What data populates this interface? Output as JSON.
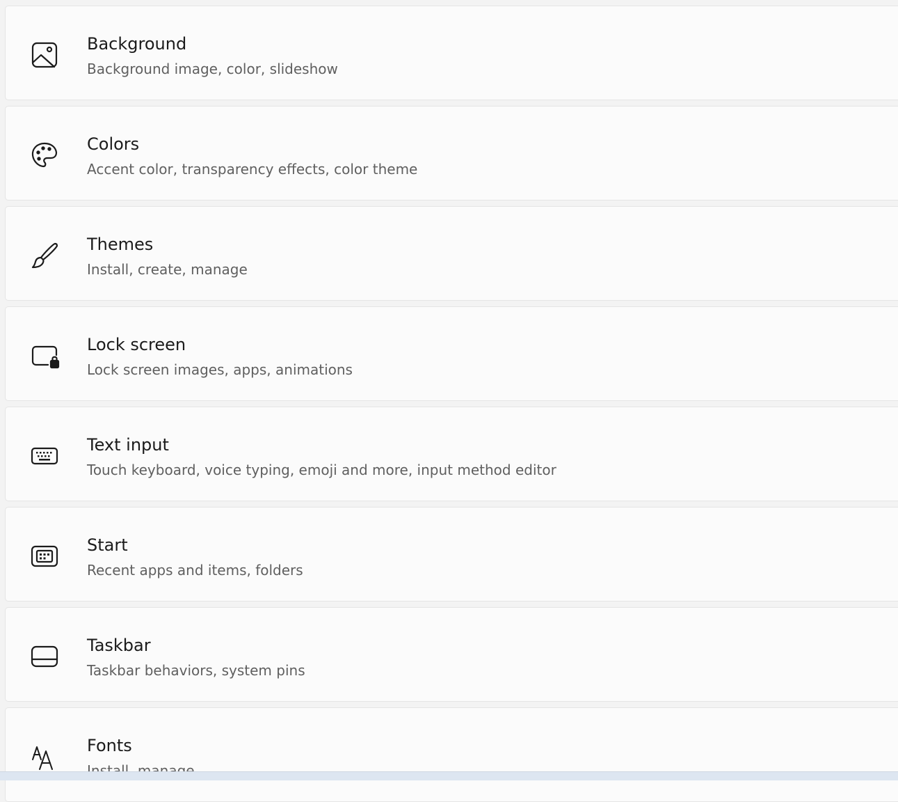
{
  "items": [
    {
      "title": "Background",
      "subtitle": "Background image, color, slideshow",
      "icon": "image-icon"
    },
    {
      "title": "Colors",
      "subtitle": "Accent color, transparency effects, color theme",
      "icon": "palette-icon"
    },
    {
      "title": "Themes",
      "subtitle": "Install, create, manage",
      "icon": "brush-icon"
    },
    {
      "title": "Lock screen",
      "subtitle": "Lock screen images, apps, animations",
      "icon": "lock-screen-icon"
    },
    {
      "title": "Text input",
      "subtitle": "Touch keyboard, voice typing, emoji and more, input method editor",
      "icon": "keyboard-icon"
    },
    {
      "title": "Start",
      "subtitle": "Recent apps and items, folders",
      "icon": "start-icon"
    },
    {
      "title": "Taskbar",
      "subtitle": "Taskbar behaviors, system pins",
      "icon": "taskbar-icon"
    },
    {
      "title": "Fonts",
      "subtitle": "Install, manage",
      "icon": "fonts-icon"
    }
  ]
}
